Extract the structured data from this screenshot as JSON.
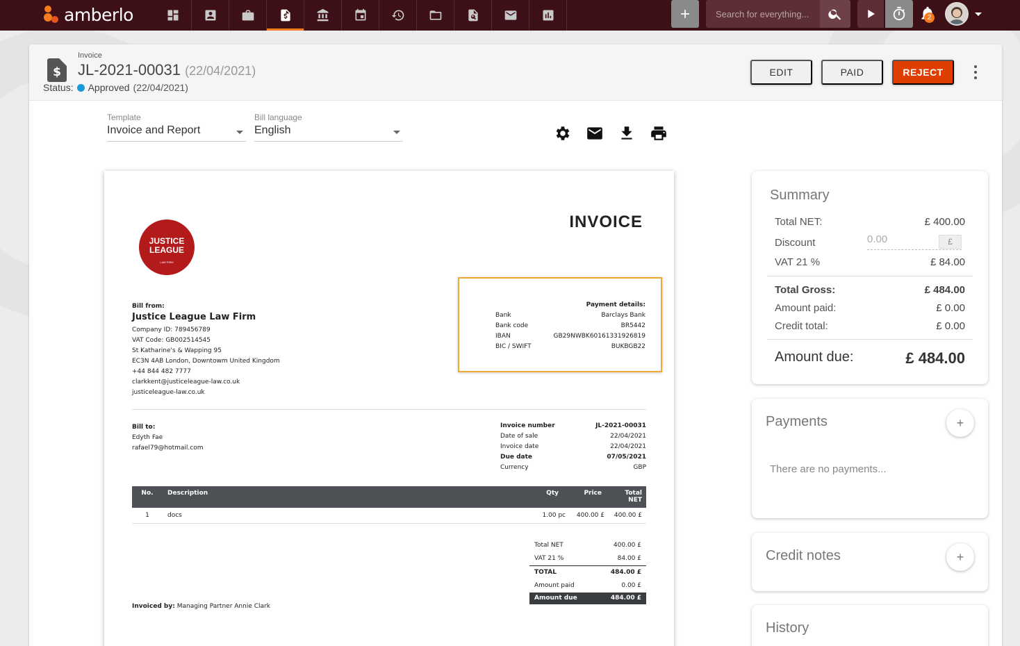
{
  "app": {
    "brand": "amberlo",
    "search_placeholder": "Search for everything...",
    "notification_count": "2"
  },
  "nav_icons": [
    "dashboard-icon",
    "contacts-icon",
    "matters-icon",
    "invoice-icon",
    "bank-icon",
    "calendar-icon",
    "time-history-icon",
    "folder-icon",
    "document-search-icon",
    "mail-icon",
    "reports-icon"
  ],
  "header": {
    "doc_type": "Invoice",
    "number": "JL-2021-00031",
    "date": "(22/04/2021)",
    "status_label": "Status:",
    "status_value": "Approved",
    "status_date": "(22/04/2021)",
    "edit_label": "EDIT",
    "paid_label": "PAID",
    "reject_label": "REJECT"
  },
  "options": {
    "template_label": "Template",
    "template_value": "Invoice and Report",
    "language_label": "Bill language",
    "language_value": "English"
  },
  "invoice": {
    "title": "INVOICE",
    "logo_line1": "JUSTICE",
    "logo_line2": "LEAGUE",
    "logo_line3": "LAW FIRM",
    "bill_from_label": "Bill from:",
    "from_name": "Justice League Law Firm",
    "from_lines": [
      "Company ID: 789456789",
      "VAT Code: GB002514545",
      "St Katharine's & Wapping 95",
      "EC3N 4AB London, Downtowm United Kingdom",
      "+44 844 482 7777",
      "clarkkent@justiceleague-law.co.uk",
      "justiceleague-law.co.uk"
    ],
    "payment_title": "Payment details:",
    "payment_rows": [
      {
        "k": "Bank",
        "v": "Barclays Bank"
      },
      {
        "k": "Bank code",
        "v": "BR5442"
      },
      {
        "k": "IBAN",
        "v": "GB29NWBK60161331926819"
      },
      {
        "k": "BIC / SWIFT",
        "v": "BUKBGB22"
      }
    ],
    "bill_to_label": "Bill to:",
    "to_lines": [
      "Edyth Fae",
      "rafael79@hotmail.com"
    ],
    "meta": [
      {
        "k": "Invoice number",
        "v": "JL-2021-00031",
        "bold": true
      },
      {
        "k": "Date of sale",
        "v": "22/04/2021",
        "bold": false
      },
      {
        "k": "Invoice date",
        "v": "22/04/2021",
        "bold": false
      },
      {
        "k": "Due date",
        "v": "07/05/2021",
        "bold": true
      },
      {
        "k": "Currency",
        "v": "GBP",
        "bold": false
      }
    ],
    "columns": {
      "no": "No.",
      "desc": "Description",
      "qty": "Qty",
      "price": "Price",
      "total1": "Total",
      "total2": "NET"
    },
    "items": [
      {
        "no": "1",
        "desc": "docs",
        "qty": "1.00 pc",
        "price": "400.00 £",
        "total": "400.00 £"
      }
    ],
    "totals": [
      {
        "k": "Total NET",
        "v": "400.00 £",
        "style": ""
      },
      {
        "k": "VAT 21 %",
        "v": "84.00 £",
        "style": ""
      },
      {
        "k": "TOTAL",
        "v": "484.00 £",
        "style": "bold"
      },
      {
        "k": "Amount paid",
        "v": "0.00 £",
        "style": ""
      },
      {
        "k": "Amount due",
        "v": "484.00 £",
        "style": "due"
      }
    ],
    "invoiced_by_label": "Invoiced by:",
    "invoiced_by": "Managing Partner Annie Clark"
  },
  "summary": {
    "title": "Summary",
    "total_net_label": "Total NET:",
    "total_net": "£ 400.00",
    "discount_label": "Discount",
    "discount_value": "0.00",
    "discount_currency": "£",
    "vat_label": "VAT 21 %",
    "vat": "£ 84.00",
    "gross_label": "Total Gross:",
    "gross": "£ 484.00",
    "paid_label": "Amount paid:",
    "paid": "£ 0.00",
    "credit_label": "Credit total:",
    "credit": "£ 0.00",
    "due_label": "Amount due:",
    "due": "£ 484.00"
  },
  "payments": {
    "title": "Payments",
    "empty": "There are no payments..."
  },
  "credit_notes": {
    "title": "Credit notes"
  },
  "history": {
    "title": "History"
  }
}
